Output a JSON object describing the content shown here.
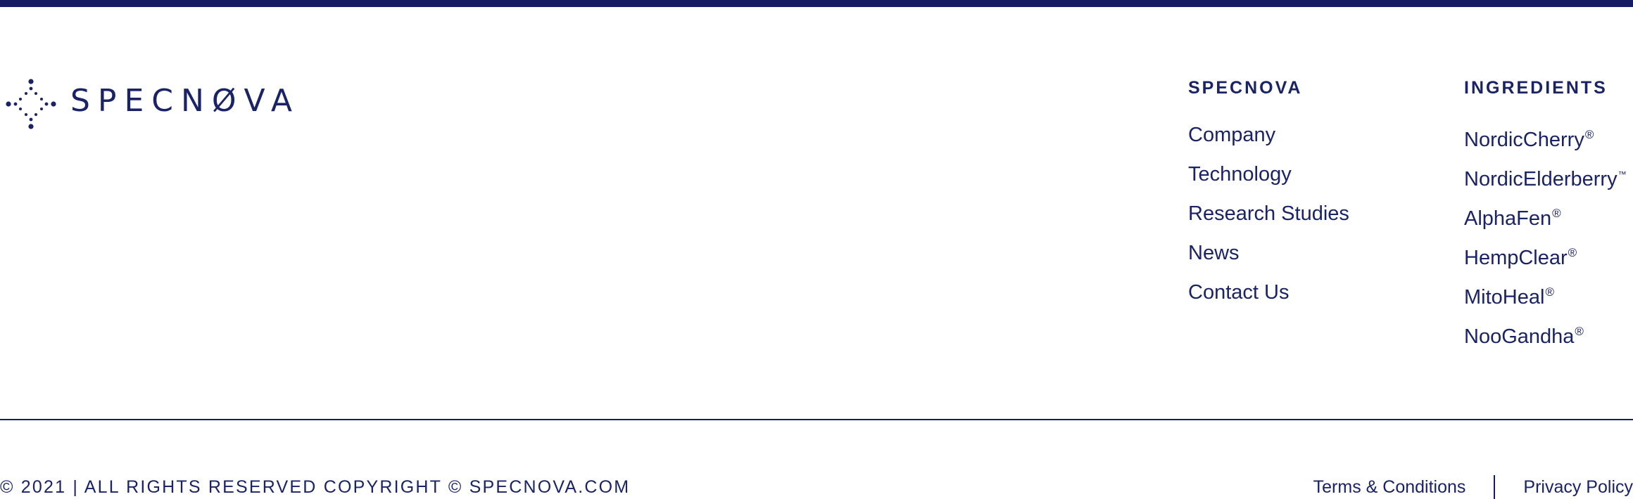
{
  "brand": {
    "name": "SPECNOVA",
    "logo_text": "SPECNØVA",
    "color": "#1a2366"
  },
  "footer": {
    "columns": [
      {
        "heading": "SPECNOVA",
        "links": [
          {
            "label": "Company"
          },
          {
            "label": "Technology"
          },
          {
            "label": "Research Studies"
          },
          {
            "label": "News"
          },
          {
            "label": "Contact Us"
          }
        ]
      },
      {
        "heading": "INGREDIENTS",
        "links": [
          {
            "label": "NordicCherry",
            "mark": "®"
          },
          {
            "label": "NordicElderberry",
            "mark": "™"
          },
          {
            "label": "AlphaFen",
            "mark": "®"
          },
          {
            "label": "HempClear",
            "mark": "®"
          },
          {
            "label": "MitoHeal",
            "mark": "®"
          },
          {
            "label": "NooGandha",
            "mark": "®"
          }
        ]
      }
    ],
    "copyright": "© 2021 | ALL RIGHTS RESERVED COPYRIGHT © SPECNOVA.COM",
    "legal_links": {
      "terms": "Terms & Conditions",
      "privacy": "Privacy Policy"
    }
  }
}
